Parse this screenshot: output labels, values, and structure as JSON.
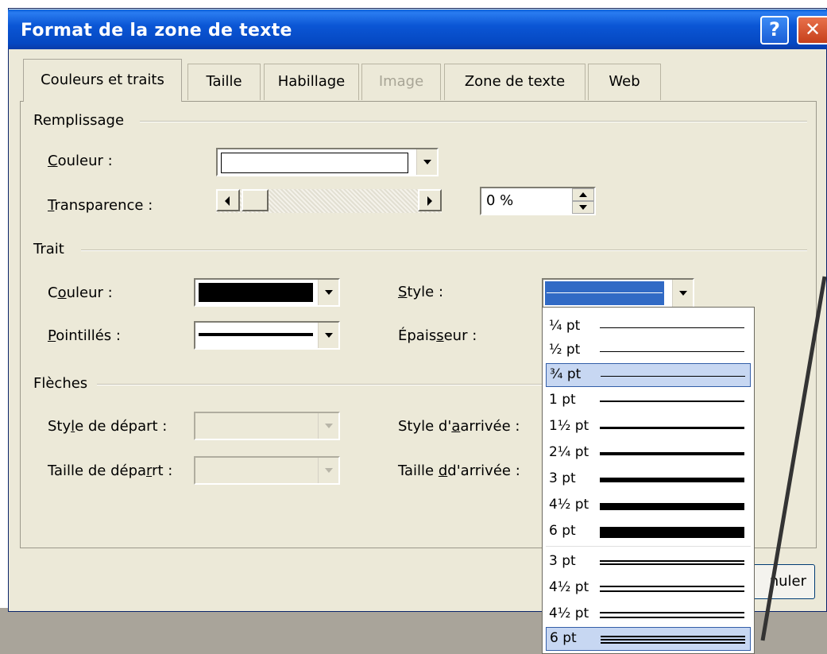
{
  "window": {
    "title": "Format de la zone de texte",
    "help_label": "?",
    "close_label": "✕"
  },
  "tabs": [
    {
      "label": "Couleurs et traits",
      "state": "active"
    },
    {
      "label": "Taille",
      "state": "normal"
    },
    {
      "label": "Habillage",
      "state": "normal"
    },
    {
      "label": "Image",
      "state": "disabled"
    },
    {
      "label": "Zone de texte",
      "state": "normal"
    },
    {
      "label": "Web",
      "state": "normal"
    }
  ],
  "fill": {
    "section": "Remplissage",
    "color_label": "Couleur :",
    "color_value": "#ffffff",
    "transparency_label": "Transparence :",
    "transparency_value": "0 %"
  },
  "line": {
    "section": "Trait",
    "color_label": "Couleur :",
    "color_value": "#000000",
    "dash_label": "Pointillés :",
    "style_label": "Style :",
    "weight_label": "Épaisseur :"
  },
  "arrows": {
    "section": "Flèches",
    "begin_style_label": "Style de départ :",
    "end_style_label": "Style d'arrivée :",
    "begin_size_label": "Taille de départ :",
    "end_size_label": "Taille d'arrivée :"
  },
  "style_options": [
    {
      "label": "¼ pt"
    },
    {
      "label": "½ pt"
    },
    {
      "label": "¾ pt",
      "selected": true
    },
    {
      "label": "1 pt"
    },
    {
      "label": "1½ pt"
    },
    {
      "label": "2¼ pt"
    },
    {
      "label": "3 pt"
    },
    {
      "label": "4½ pt"
    },
    {
      "label": "6 pt"
    },
    {
      "label": "3 pt"
    },
    {
      "label": "4½ pt"
    },
    {
      "label": "4½ pt"
    },
    {
      "label": "6 pt",
      "highlighted": true
    }
  ],
  "buttons": {
    "cancel_partial": "nuler"
  },
  "colors": {
    "title_blue": "#0b56d5",
    "selection": "#c7d7f2",
    "dialog_bg": "#ece9d8"
  }
}
